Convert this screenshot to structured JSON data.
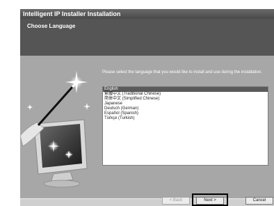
{
  "window": {
    "title": "Intelligent IP Installer Installation",
    "header_title": "Choose Language"
  },
  "main": {
    "instruction": "Please select the language that you would like to install and use during the installation.",
    "languages": [
      "English",
      "繁體中文 (Traditional Chinese)",
      "简体中文 (Simplified Chinese)",
      "Japanese",
      "Deutsch (German)",
      "Español (Spanish)",
      "Türkçe (Turkish)"
    ],
    "selected_language": "English"
  },
  "buttons": {
    "back": "< Back",
    "next": "Next >",
    "cancel": "Cancel"
  }
}
